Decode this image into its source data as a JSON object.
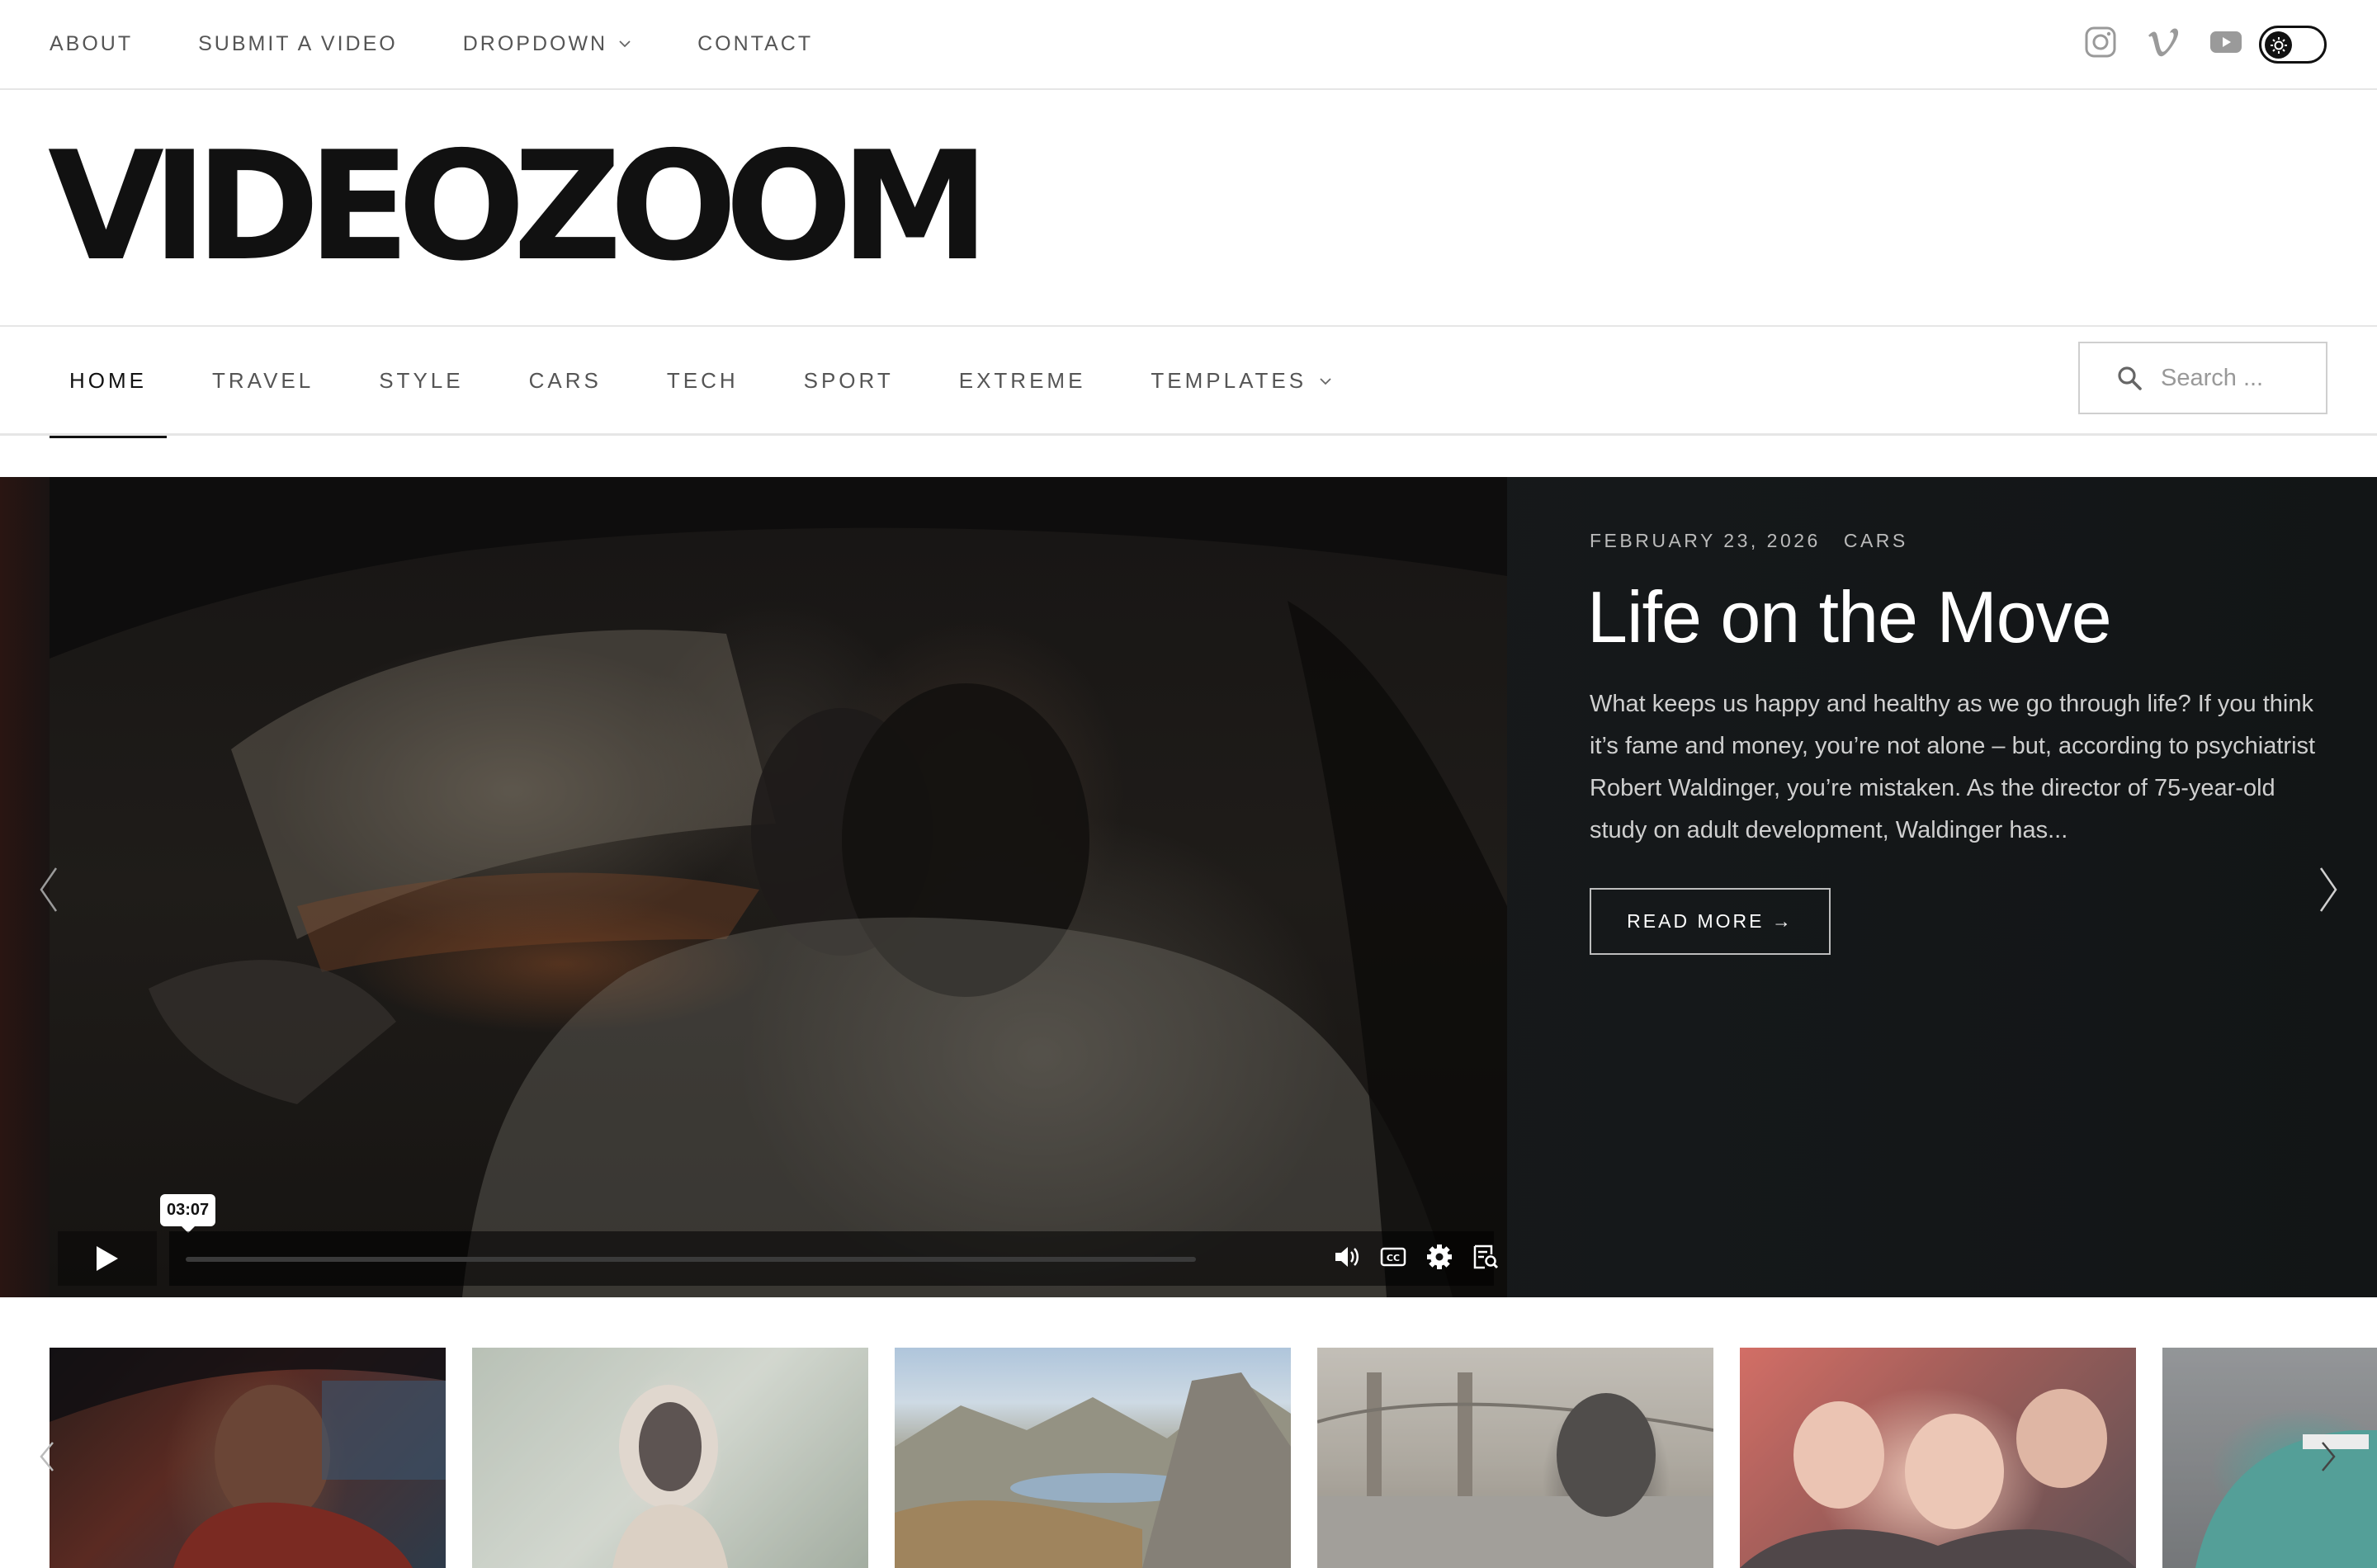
{
  "topnav": {
    "items": [
      {
        "label": "ABOUT"
      },
      {
        "label": "SUBMIT A VIDEO"
      },
      {
        "label": "DROPDOWN",
        "has_dropdown": true
      },
      {
        "label": "CONTACT"
      }
    ],
    "social_icons": [
      "instagram-icon",
      "vimeo-icon",
      "youtube-icon"
    ],
    "theme_toggle_icon": "sun-icon"
  },
  "site": {
    "logo": "VIDEOZOOM"
  },
  "mainnav": {
    "items": [
      {
        "label": "HOME",
        "active": true
      },
      {
        "label": "TRAVEL"
      },
      {
        "label": "STYLE"
      },
      {
        "label": "CARS"
      },
      {
        "label": "TECH"
      },
      {
        "label": "SPORT"
      },
      {
        "label": "EXTREME"
      },
      {
        "label": "TEMPLATES",
        "has_dropdown": true
      }
    ],
    "search_placeholder": "Search ..."
  },
  "hero": {
    "date": "FEBRUARY 23, 2026",
    "category": "CARS",
    "title": "Life on the Move",
    "excerpt": "What keeps us happy and healthy as we go through life? If you think it’s fame and money, you’re not alone – but, according to psychiatrist Robert Waldinger, you’re mistaken. As the director of 75-year-old study on adult development, Waldinger has...",
    "read_more": "READ MORE →",
    "player": {
      "time_tooltip": "03:07",
      "progress": 0,
      "controls": [
        "volume-icon",
        "captions-icon",
        "settings-icon",
        "transcript-icon",
        "picture-in-picture-icon",
        "fullscreen-icon"
      ]
    }
  },
  "colors": {
    "text_dark": "#111111",
    "text_muted": "#555555",
    "hero_bg": "#16191b",
    "border": "#e6e6e6"
  }
}
